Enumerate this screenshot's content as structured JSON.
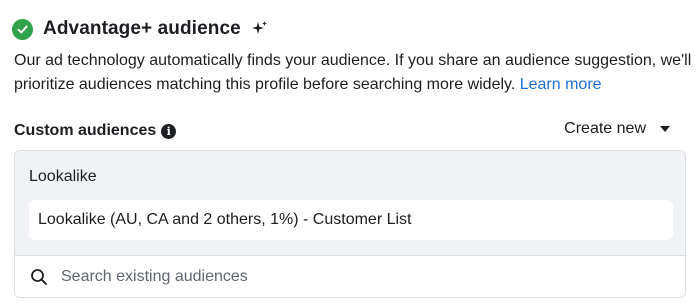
{
  "header": {
    "title": "Advantage+ audience",
    "status_icon": "check-circle-icon",
    "status_color": "#31a24c",
    "badge_icon": "sparkle-icon"
  },
  "description": {
    "text": "Our ad technology automatically finds your audience. If you share an audience suggestion, we'll prioritize audiences matching this profile before searching more widely.",
    "link_label": "Learn more",
    "link_color": "#216fdb"
  },
  "custom_audiences": {
    "label": "Custom audiences",
    "info_icon": "info-icon",
    "create_new_label": "Create new",
    "create_new_icon": "caret-down-icon",
    "selected_group": {
      "label": "Lookalike",
      "items": [
        {
          "label": "Lookalike (AU, CA and 2 others, 1%) - Customer List"
        }
      ]
    },
    "search": {
      "icon": "search-icon",
      "placeholder": "Search existing audiences",
      "value": ""
    }
  }
}
